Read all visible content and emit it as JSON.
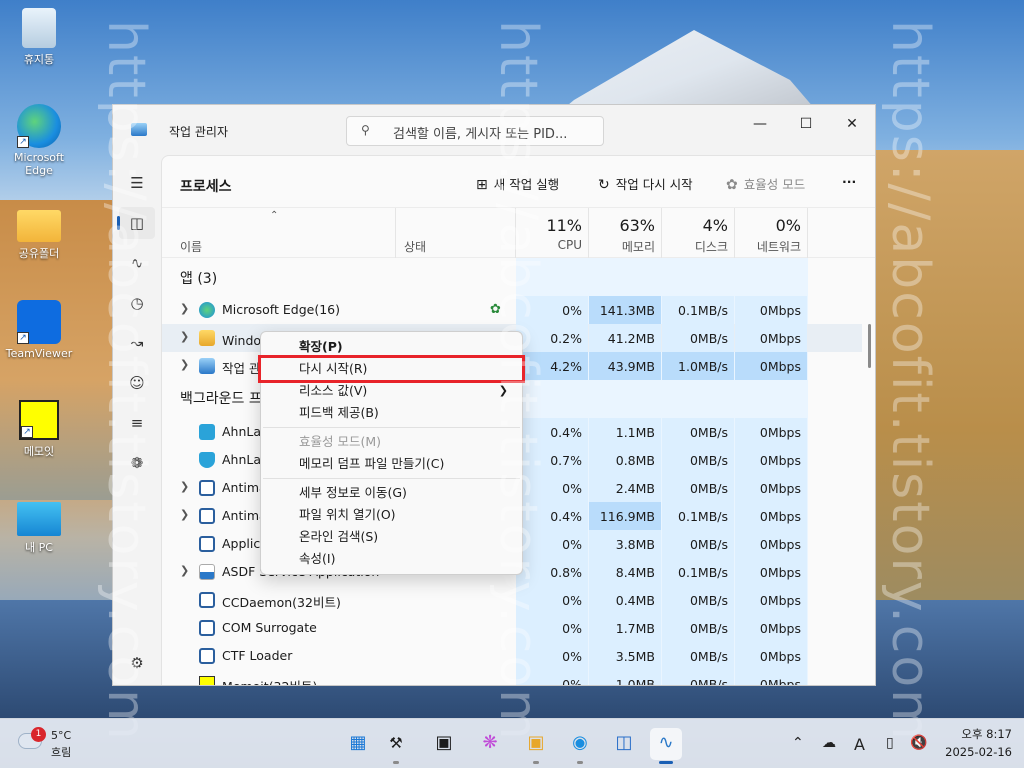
{
  "desktop": {
    "icons": [
      {
        "label": "휴지통"
      },
      {
        "label": "Microsoft Edge"
      },
      {
        "label": "공유폴더"
      },
      {
        "label": "TeamViewer"
      },
      {
        "label": "메모잇"
      },
      {
        "label": "내 PC"
      }
    ],
    "watermark": "https://abcofit.tistory.com"
  },
  "window": {
    "title": "작업 관리자",
    "search_placeholder": "검색할 이름, 게시자 또는 PID...",
    "minimize_icon": "minimize-icon",
    "maximize_icon": "maximize-icon",
    "close_icon": "close-icon"
  },
  "nav": {
    "items": [
      {
        "icon": "hamburger-icon"
      },
      {
        "icon": "processes-icon",
        "active": true
      },
      {
        "icon": "performance-icon"
      },
      {
        "icon": "app-history-icon"
      },
      {
        "icon": "startup-apps-icon"
      },
      {
        "icon": "users-icon"
      },
      {
        "icon": "details-icon"
      },
      {
        "icon": "services-icon"
      },
      {
        "icon": "settings-icon"
      }
    ]
  },
  "toolbar": {
    "page_title": "프로세스",
    "run_new_task": "새 작업 실행",
    "restart_task": "작업 다시 시작",
    "efficiency_mode": "효율성 모드",
    "more": "···"
  },
  "columns": {
    "name": "이름",
    "status": "상태",
    "cpu_pct": "11%",
    "cpu": "CPU",
    "mem_pct": "63%",
    "mem": "메모리",
    "disk_pct": "4%",
    "disk": "디스크",
    "net_pct": "0%",
    "net": "네트워크"
  },
  "groups": {
    "apps": "앱 (3)",
    "background": "백그라운드 프로세스 (87)"
  },
  "apps": [
    {
      "name": "Microsoft Edge(16)",
      "cpu": "0%",
      "mem": "141.3MB",
      "disk": "0.1MB/s",
      "net": "0Mbps"
    },
    {
      "name": "Windows 탐색기",
      "cpu": "0.2%",
      "mem": "41.2MB",
      "disk": "0MB/s",
      "net": "0Mbps"
    },
    {
      "name": "작업 관리자",
      "cpu": "4.2%",
      "mem": "43.9MB",
      "disk": "1.0MB/s",
      "net": "0Mbps"
    }
  ],
  "background": [
    {
      "name": "AhnLab Safe Transaction",
      "cpu": "0.4%",
      "mem": "1.1MB",
      "disk": "0MB/s",
      "net": "0Mbps"
    },
    {
      "name": "AhnLab Safe Transaction",
      "cpu": "0.7%",
      "mem": "0.8MB",
      "disk": "0MB/s",
      "net": "0Mbps"
    },
    {
      "name": "Antimalware Core Service",
      "cpu": "0%",
      "mem": "2.4MB",
      "disk": "0MB/s",
      "net": "0Mbps"
    },
    {
      "name": "Antimalware Service Executable",
      "cpu": "0.4%",
      "mem": "116.9MB",
      "disk": "0.1MB/s",
      "net": "0Mbps"
    },
    {
      "name": "Application Frame Host",
      "cpu": "0%",
      "mem": "3.8MB",
      "disk": "0MB/s",
      "net": "0Mbps"
    },
    {
      "name": "ASDF Service Application",
      "cpu": "0.8%",
      "mem": "8.4MB",
      "disk": "0.1MB/s",
      "net": "0Mbps"
    },
    {
      "name": "CCDaemon(32비트)",
      "cpu": "0%",
      "mem": "0.4MB",
      "disk": "0MB/s",
      "net": "0Mbps"
    },
    {
      "name": "COM Surrogate",
      "cpu": "0%",
      "mem": "1.7MB",
      "disk": "0MB/s",
      "net": "0Mbps"
    },
    {
      "name": "CTF Loader",
      "cpu": "0%",
      "mem": "3.5MB",
      "disk": "0MB/s",
      "net": "0Mbps"
    },
    {
      "name": "Memoit(32비트)",
      "cpu": "0%",
      "mem": "1.0MB",
      "disk": "0MB/s",
      "net": "0Mbps"
    }
  ],
  "context_menu": {
    "expand": "확장(P)",
    "restart": "다시 시작(R)",
    "resource_values": "리소스 값(V)",
    "feedback": "피드백 제공(B)",
    "efficiency": "효율성 모드(M)",
    "dump": "메모리 덤프 파일 만들기(C)",
    "details": "세부 정보로 이동(G)",
    "open_location": "파일 위치 열기(O)",
    "search_online": "온라인 검색(S)",
    "properties": "속성(I)"
  },
  "taskbar": {
    "weather_badge": "1",
    "weather_temp": "5°C",
    "weather_cond": "흐림",
    "time": "오후 8:17",
    "date": "2025-02-16",
    "ime": "A"
  },
  "colors": {
    "accent": "#1a5fb4",
    "highlight_border": "#e8242a",
    "metric_bg": "#dcefff",
    "metric_hi": "#b9dcfb"
  }
}
